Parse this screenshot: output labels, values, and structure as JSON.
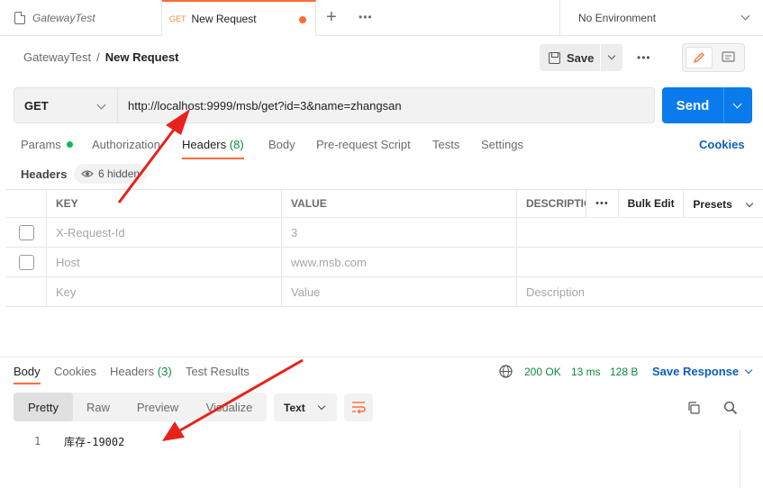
{
  "tabs": {
    "collection_tab": "GatewayTest",
    "request_tab": {
      "method": "GET",
      "title": "New Request"
    },
    "environment": "No Environment"
  },
  "breadcrumb": {
    "collection": "GatewayTest",
    "separator": "/",
    "request": "New Request"
  },
  "toolbar": {
    "save_label": "Save"
  },
  "request": {
    "method": "GET",
    "url": "http://localhost:9999/msb/get?id=3&name=zhangsan",
    "send_label": "Send"
  },
  "request_tabs": {
    "params": "Params",
    "authorization": "Authorization",
    "headers": "Headers",
    "headers_count": "(8)",
    "body": "Body",
    "pre_request": "Pre-request Script",
    "tests": "Tests",
    "settings": "Settings",
    "cookies": "Cookies"
  },
  "headers_section": {
    "label": "Headers",
    "hidden": "6 hidden"
  },
  "headers_table": {
    "columns": {
      "key": "KEY",
      "value": "VALUE",
      "description": "DESCRIPTION"
    },
    "bulk_edit": "Bulk Edit",
    "presets": "Presets",
    "rows": [
      {
        "key": "X-Request-Id",
        "value": "3"
      },
      {
        "key": "Host",
        "value": "www.msb.com"
      }
    ],
    "placeholder": {
      "key": "Key",
      "value": "Value",
      "description": "Description"
    }
  },
  "response": {
    "tabs": {
      "body": "Body",
      "cookies": "Cookies",
      "headers": "Headers",
      "headers_count": "(3)",
      "test_results": "Test Results"
    },
    "status": "200 OK",
    "time": "13 ms",
    "size": "128 B",
    "save_response": "Save Response",
    "views": [
      "Pretty",
      "Raw",
      "Preview",
      "Visualize"
    ],
    "format": "Text",
    "lines": [
      {
        "number": "1",
        "text": "库存-19002"
      }
    ]
  },
  "colors": {
    "accent": "#ff6c37",
    "send": "#097bed",
    "link": "#0b5fc1",
    "status_ok": "#0c8a3e",
    "annotation_arrow": "#e8221b"
  }
}
